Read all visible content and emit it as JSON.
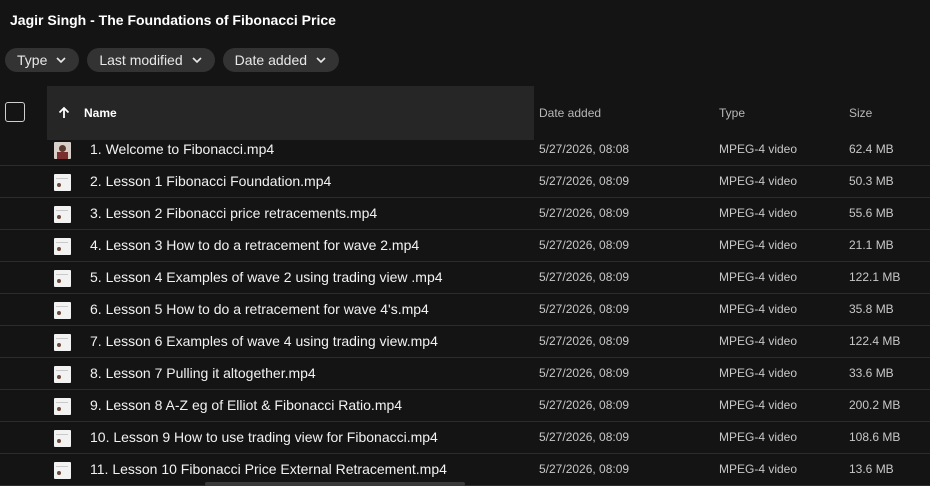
{
  "title": "Jagir Singh - The Foundations of Fibonacci Price",
  "filters": [
    {
      "label": "Type"
    },
    {
      "label": "Last modified"
    },
    {
      "label": "Date added"
    }
  ],
  "columns": {
    "name": "Name",
    "date_added": "Date added",
    "type": "Type",
    "size": "Size",
    "sort_direction": "ascending"
  },
  "files": [
    {
      "name": "1. Welcome to Fibonacci.mp4",
      "date": "5/27/2026, 08:08",
      "type": "MPEG-4 video",
      "size": "62.4 MB",
      "thumb": "face"
    },
    {
      "name": "2. Lesson 1 Fibonacci Foundation.mp4",
      "date": "5/27/2026, 08:09",
      "type": "MPEG-4 video",
      "size": "50.3 MB",
      "thumb": "chart"
    },
    {
      "name": "3. Lesson 2 Fibonacci price retracements.mp4",
      "date": "5/27/2026, 08:09",
      "type": "MPEG-4 video",
      "size": "55.6 MB",
      "thumb": "chart"
    },
    {
      "name": "4. Lesson 3 How to do a retracement for wave 2.mp4",
      "date": "5/27/2026, 08:09",
      "type": "MPEG-4 video",
      "size": "21.1 MB",
      "thumb": "chart"
    },
    {
      "name": "5. Lesson 4 Examples of wave 2 using trading view .mp4",
      "date": "5/27/2026, 08:09",
      "type": "MPEG-4 video",
      "size": "122.1 MB",
      "thumb": "chart"
    },
    {
      "name": "6. Lesson 5 How to do a retracement for wave 4's.mp4",
      "date": "5/27/2026, 08:09",
      "type": "MPEG-4 video",
      "size": "35.8 MB",
      "thumb": "chart"
    },
    {
      "name": "7. Lesson 6 Examples of wave 4 using trading view.mp4",
      "date": "5/27/2026, 08:09",
      "type": "MPEG-4 video",
      "size": "122.4 MB",
      "thumb": "chart"
    },
    {
      "name": "8. Lesson 7 Pulling it altogether.mp4",
      "date": "5/27/2026, 08:09",
      "type": "MPEG-4 video",
      "size": "33.6 MB",
      "thumb": "chart"
    },
    {
      "name": "9. Lesson 8 A-Z eg of Elliot & Fibonacci Ratio.mp4",
      "date": "5/27/2026, 08:09",
      "type": "MPEG-4 video",
      "size": "200.2 MB",
      "thumb": "chart"
    },
    {
      "name": "10. Lesson 9 How to use trading view for Fibonacci.mp4",
      "date": "5/27/2026, 08:09",
      "type": "MPEG-4 video",
      "size": "108.6 MB",
      "thumb": "chart"
    },
    {
      "name": "11. Lesson 10 Fibonacci Price External Retracement.mp4",
      "date": "5/27/2026, 08:09",
      "type": "MPEG-4 video",
      "size": "13.6 MB",
      "thumb": "chart"
    }
  ],
  "icons": {
    "sort": "arrow-up-icon",
    "chip": "chevron-down-icon",
    "file": "video-thumbnail-icon"
  }
}
